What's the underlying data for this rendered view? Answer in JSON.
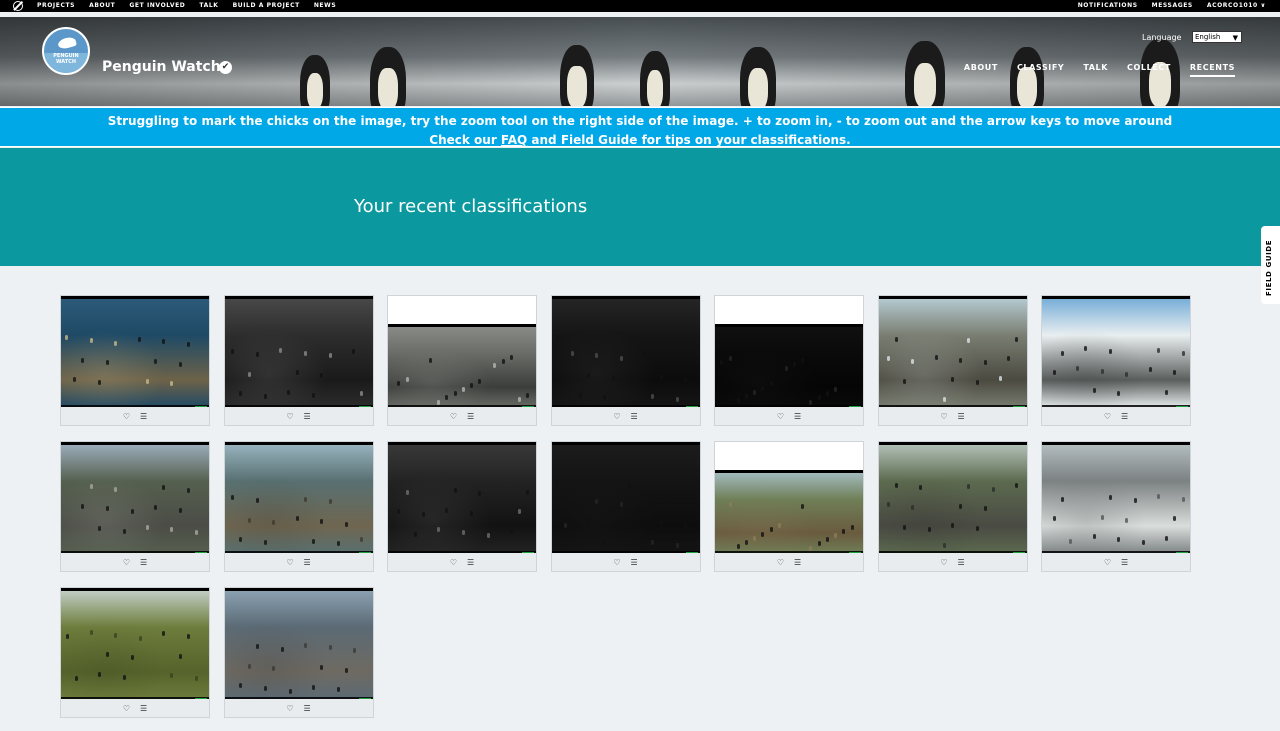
{
  "topnav": {
    "items": [
      "PROJECTS",
      "ABOUT",
      "GET INVOLVED",
      "TALK",
      "BUILD A PROJECT",
      "NEWS"
    ],
    "right": [
      "NOTIFICATIONS",
      "MESSAGES",
      "ACORCO1010 ∨"
    ]
  },
  "project": {
    "title": "Penguin Watch",
    "avatar_text": "PENGUIN WATCH",
    "verified_icon": "✔",
    "language_label": "Language",
    "language_value": "English",
    "nav": [
      "ABOUT",
      "CLASSIFY",
      "TALK",
      "COLLECT",
      "RECENTS"
    ],
    "active_nav": "RECENTS"
  },
  "announcement": {
    "line1": "Struggling to mark the chicks on the image, try the zoom tool on the right side of the image. + to zoom in, - to zoom out and the arrow keys to move around",
    "line2_pre": "Check our ",
    "line2_link": "FAQ",
    "line2_post": " and Field Guide for tips on your classifications."
  },
  "page": {
    "title": "Your recent classifications",
    "field_guide": "FIELD GUIDE"
  },
  "card_actions": {
    "favorite_icon": "♡",
    "collect_icon": "☰"
  },
  "recents": [
    {
      "tone": "ocean",
      "colors": [
        "#2d5b7a",
        "#1f4a66",
        "#6d6248",
        "#c7b78a"
      ]
    },
    {
      "tone": "night-gray",
      "colors": [
        "#4a4a4a",
        "#2d2d2d",
        "#1a1a1a",
        "#8a8a8a"
      ]
    },
    {
      "tone": "colony-gray",
      "colors": [
        "#8c8e8a",
        "#6a6c68",
        "#3c3e3b",
        "#b5b5b0"
      ]
    },
    {
      "tone": "night-dark",
      "colors": [
        "#262626",
        "#151515",
        "#0c0c0c",
        "#4d4d4d"
      ]
    },
    {
      "tone": "night-black",
      "colors": [
        "#111111",
        "#0a0a0a",
        "#050505",
        "#252525"
      ]
    },
    {
      "tone": "snow-slope",
      "colors": [
        "#b8cfd6",
        "#7a7e72",
        "#4b4a40",
        "#d9e2e3"
      ]
    },
    {
      "tone": "mountain-snow",
      "colors": [
        "#6fa9d6",
        "#e9eef0",
        "#5a5e5c",
        "#2d2f2f"
      ]
    },
    {
      "tone": "colony-field",
      "colors": [
        "#9fb1c1",
        "#55604f",
        "#4b4c46",
        "#a7a8a0"
      ]
    },
    {
      "tone": "rocky-shore",
      "colors": [
        "#9cb7c4",
        "#587071",
        "#6f6650",
        "#3f3a30"
      ]
    },
    {
      "tone": "night-colony",
      "colors": [
        "#3a3a3a",
        "#232323",
        "#121212",
        "#6e6e6e"
      ]
    },
    {
      "tone": "night-empty",
      "colors": [
        "#1c1c1c",
        "#141414",
        "#0d0d0d",
        "#262626"
      ]
    },
    {
      "tone": "grass-plain",
      "colors": [
        "#a8c0c9",
        "#6f7f57",
        "#6a5b3e",
        "#8c7d5a"
      ]
    },
    {
      "tone": "colony-slope",
      "colors": [
        "#b7c6bd",
        "#5c6a4f",
        "#4a4b43",
        "#2c2d2a"
      ]
    },
    {
      "tone": "snowy-rocks",
      "colors": [
        "#b6c0c2",
        "#7c8182",
        "#d9dddb",
        "#525657"
      ]
    },
    {
      "tone": "tussock",
      "colors": [
        "#c8d3cf",
        "#6d7d3c",
        "#56632b",
        "#3b4220"
      ]
    },
    {
      "tone": "mountain-colony",
      "colors": [
        "#8ea4b6",
        "#5b6a74",
        "#6e6a62",
        "#3b3936"
      ]
    }
  ]
}
